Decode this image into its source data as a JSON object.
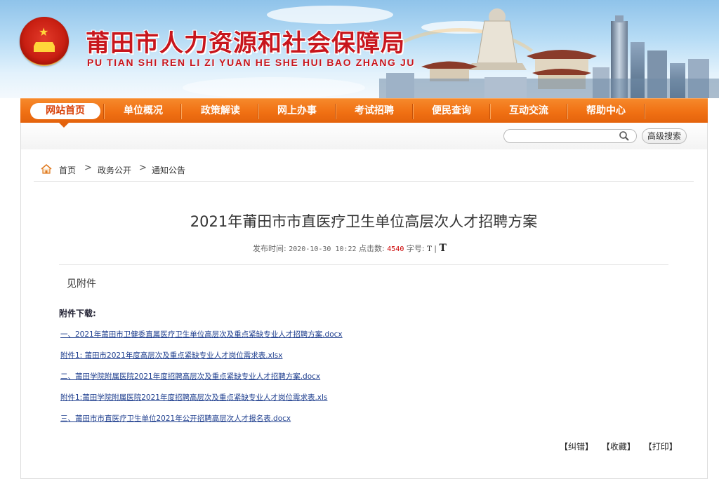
{
  "header": {
    "title": "莆田市人力资源和社会保障局",
    "pinyin": "PU TIAN SHI REN LI ZI YUAN HE SHE HUI BAO ZHANG JU"
  },
  "nav": {
    "items": [
      {
        "label": "网站首页",
        "active": true
      },
      {
        "label": "单位概况"
      },
      {
        "label": "政策解读"
      },
      {
        "label": "网上办事"
      },
      {
        "label": "考试招聘"
      },
      {
        "label": "便民查询"
      },
      {
        "label": "互动交流"
      },
      {
        "label": "帮助中心"
      }
    ]
  },
  "search": {
    "value": "",
    "placeholder": "",
    "advanced_label": "高级搜索"
  },
  "breadcrumb": {
    "items": [
      "首页",
      "政务公开",
      "通知公告"
    ],
    "separator": ">"
  },
  "article": {
    "title": "2021年莆田市市直医疗卫生单位高层次人才招聘方案",
    "meta": {
      "published_label": "发布时间:",
      "published_value": "2020-10-30 10:22",
      "clicks_label": "点击数:",
      "clicks_value": "4540",
      "fontsize_label": "字号:",
      "small_font": "T",
      "divider": "|",
      "large_font": "T"
    },
    "body": "见附件",
    "attachments_heading": "附件下载:",
    "attachments": [
      "一、2021年莆田市卫健委直属医疗卫生单位高层次及重点紧缺专业人才招聘方案.docx",
      "附件1:  莆田市2021年度高层次及重点紧缺专业人才岗位需求表.xlsx",
      "二、莆田学院附属医院2021年度招聘高层次及重点紧缺专业人才招聘方案.docx",
      "附件1:莆田学院附属医院2021年度招聘高层次及重点紧缺专业人才岗位需求表.xls",
      "三、莆田市市直医疗卫生单位2021年公开招聘高层次人才报名表.docx"
    ],
    "actions": [
      "【纠错】",
      "【收藏】",
      "【打印】"
    ]
  },
  "colors": {
    "brand_red": "#c8161d",
    "nav_orange": "#f07013",
    "link_blue": "#1f3f8f",
    "clicks_red": "#cc0000"
  }
}
